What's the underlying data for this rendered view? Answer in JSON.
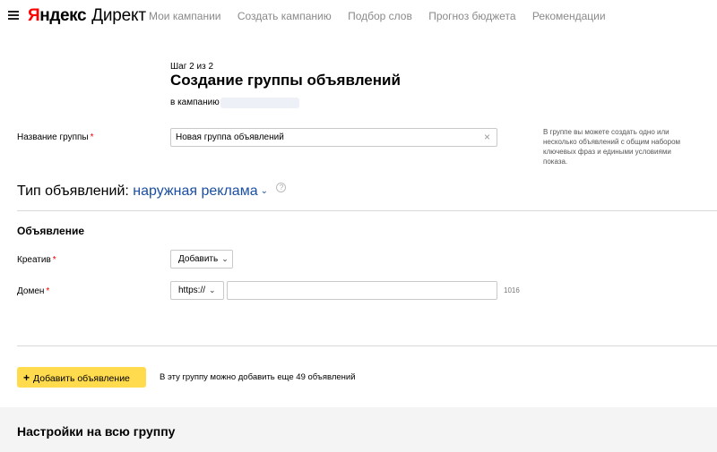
{
  "header": {
    "logo_first_letter": "Я",
    "logo_rest": "ндекс",
    "logo_product": "Директ",
    "nav": [
      "Мои кампании",
      "Создать кампанию",
      "Подбор слов",
      "Прогноз бюджета",
      "Рекомендации"
    ]
  },
  "wizard": {
    "step": "Шаг 2 из 2",
    "title": "Создание группы объявлений",
    "campaign_prefix": "в кампанию"
  },
  "group": {
    "name_label": "Название группы",
    "required_mark": "*",
    "name_value": "Новая группа объявлений",
    "clear_icon": "×",
    "hint": "В группе вы можете создать одно или несколько объявлений с общим набором ключевых фраз и едиными условиями показа."
  },
  "ads_type": {
    "label": "Тип объявлений:",
    "value": "наружная реклама",
    "chevron_icon": "⌄",
    "help_icon": "?"
  },
  "ad": {
    "section_title": "Объявление",
    "creative_label": "Креатив",
    "creative_button": "Добавить",
    "domain_label": "Домен",
    "protocol": "https://",
    "domain_value": "",
    "domain_counter": "1016",
    "dropdown_icon": "⌄"
  },
  "actions": {
    "add_ad_plus": "+",
    "add_ad_label": "Добавить объявление",
    "note": "В эту группу можно добавить еще 49 объявлений"
  },
  "group_settings": {
    "title": "Настройки на всю группу"
  },
  "colors": {
    "brand_red": "#ff0000",
    "link_blue": "#1a4fa3",
    "button_yellow": "#ffdb4d",
    "required": "#ee0000"
  }
}
